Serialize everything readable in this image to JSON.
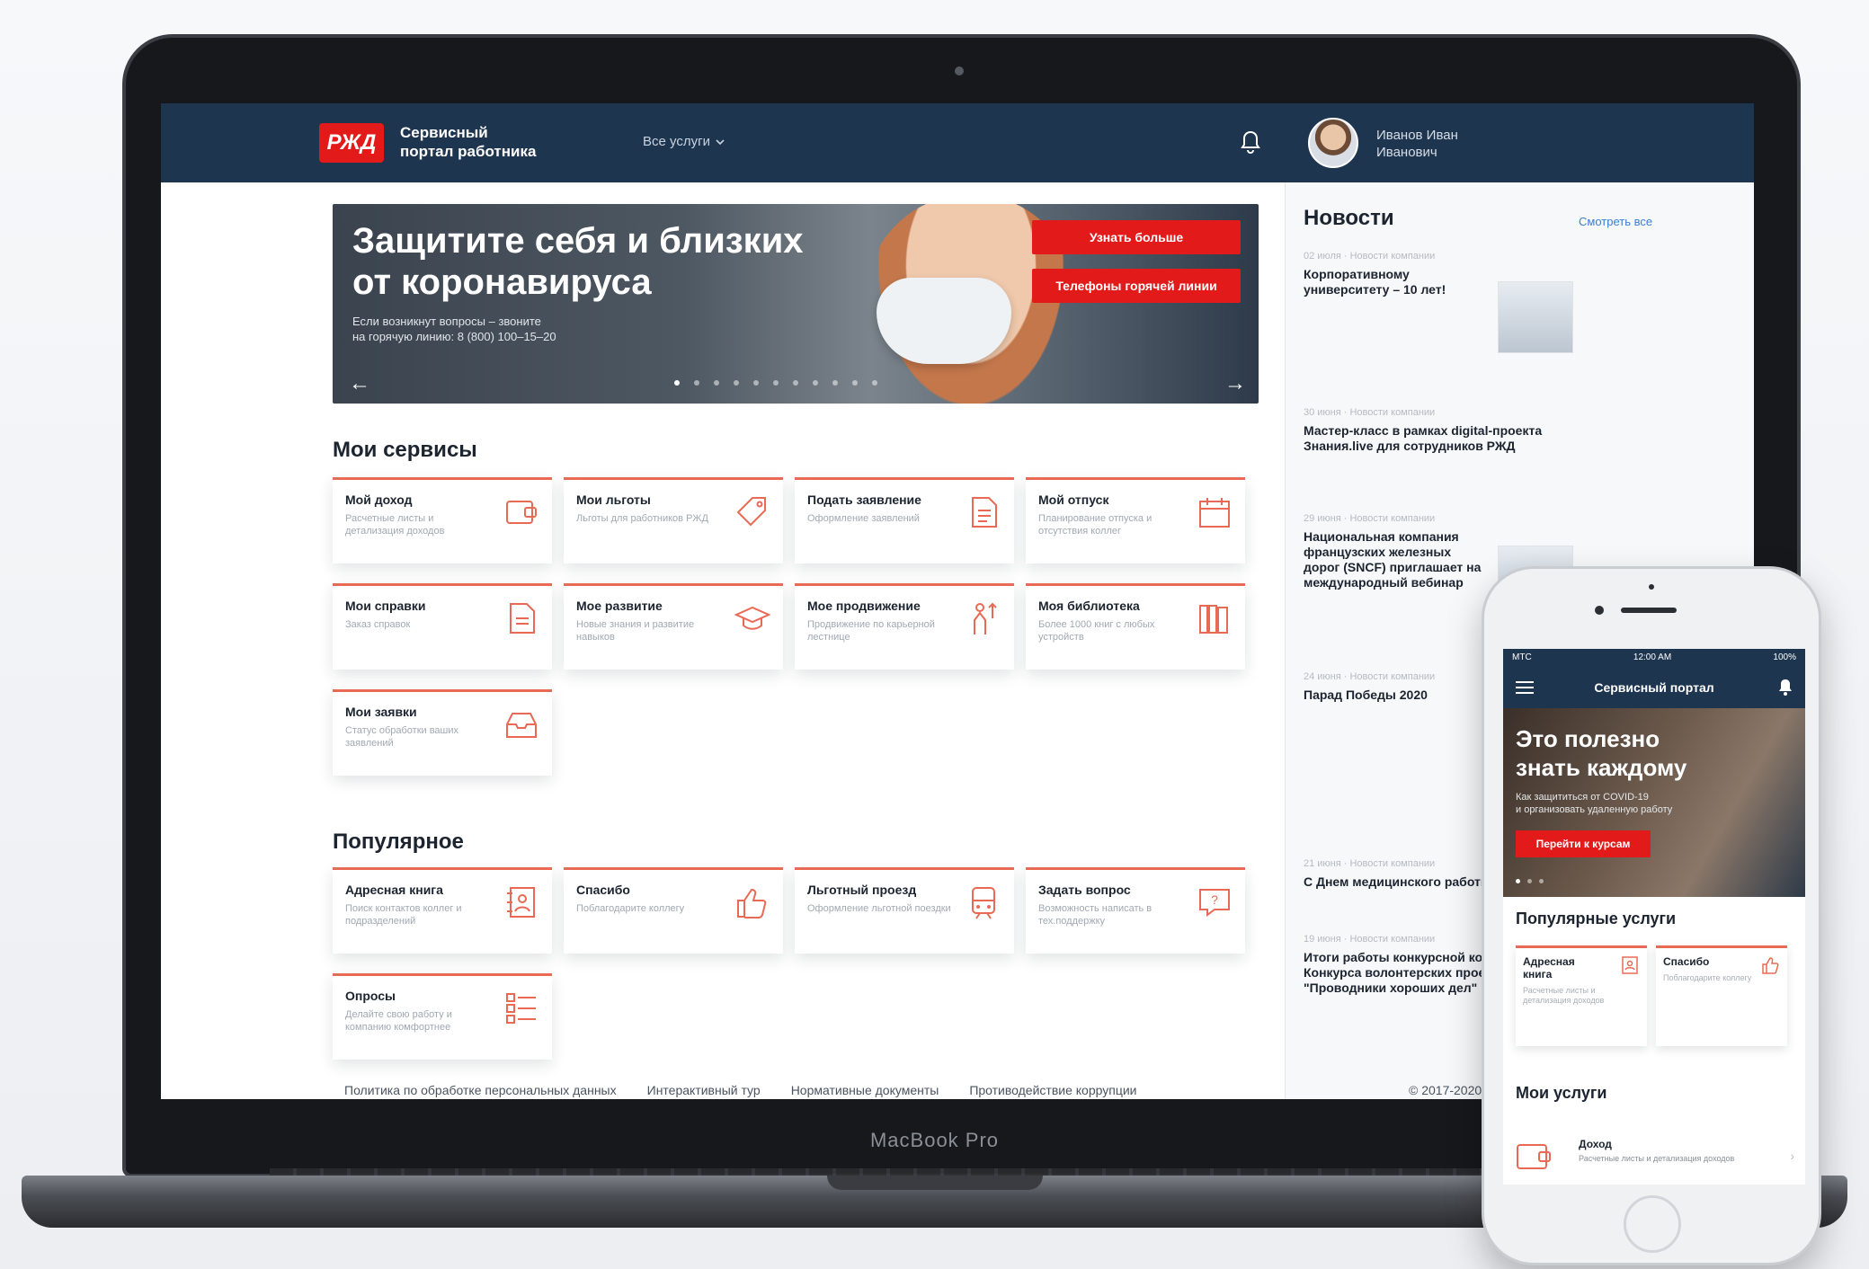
{
  "device": {
    "laptop_label": "MacBook Pro"
  },
  "header": {
    "brand_line1": "Сервисный",
    "brand_line2": "портал работника",
    "logo_text": "РЖД",
    "nav_services": "Все услуги",
    "user_name_line1": "Иванов Иван",
    "user_name_line2": "Иванович"
  },
  "hero": {
    "title_line1": "Защитите себя и близких",
    "title_line2": "от коронавируса",
    "subtitle_line1": "Если возникнут вопросы – звоните",
    "subtitle_line2": "на горячую линию: 8 (800) 100–15–20",
    "button_more": "Узнать больше",
    "button_hotline": "Телефоны горячей линии"
  },
  "my_services": {
    "title": "Мои сервисы",
    "items": [
      {
        "title": "Мой доход",
        "desc": "Расчетные листы и детализация доходов",
        "icon": "wallet-icon"
      },
      {
        "title": "Мои льготы",
        "desc": "Льготы для работников РЖД",
        "icon": "tag-icon"
      },
      {
        "title": "Подать заявление",
        "desc": "Оформление заявлений",
        "icon": "document-icon"
      },
      {
        "title": "Мой отпуск",
        "desc": "Планирование отпуска и отсутствия коллег",
        "icon": "calendar-icon"
      },
      {
        "title": "Мои справки",
        "desc": "Заказ справок",
        "icon": "certificate-icon"
      },
      {
        "title": "Мое развитие",
        "desc": "Новые знания и развитие навыков",
        "icon": "graduation-cap-icon"
      },
      {
        "title": "Мое продвижение",
        "desc": "Продвижение по карьерной лестнице",
        "icon": "career-icon"
      },
      {
        "title": "Моя библиотека",
        "desc": "Более 1000 книг с любых устройств",
        "icon": "library-icon"
      },
      {
        "title": "Мои заявки",
        "desc": "Статус обработки ваших заявлений",
        "icon": "inbox-icon"
      }
    ]
  },
  "popular": {
    "title": "Популярное",
    "items": [
      {
        "title": "Адресная книга",
        "desc": "Поиск контактов коллег и подразделений",
        "icon": "address-book-icon"
      },
      {
        "title": "Спасибо",
        "desc": "Поблагодарите коллегу",
        "icon": "thumbs-up-icon"
      },
      {
        "title": "Льготный проезд",
        "desc": "Оформление льготной поездки",
        "icon": "train-icon"
      },
      {
        "title": "Задать вопрос",
        "desc": "Возможность написать в тех.поддержку",
        "icon": "question-icon"
      },
      {
        "title": "Опросы",
        "desc": "Делайте свою работу и компанию комфортнее",
        "icon": "survey-icon"
      }
    ]
  },
  "news": {
    "title": "Новости",
    "see_all": "Смотреть все",
    "items": [
      {
        "meta": "02 июля · Новости компании",
        "headline": "Корпоративному университету – 10 лет!"
      },
      {
        "meta": "30 июня · Новости компании",
        "headline": "Мастер-класс в рамках digital-проекта Знания.live для сотрудников РЖД"
      },
      {
        "meta": "29 июня · Новости компании",
        "headline": "Национальная компания французских железных дорог (SNCF) приглашает на международный вебинар"
      },
      {
        "meta": "24 июня · Новости компании",
        "headline": "Парад Победы 2020"
      },
      {
        "meta": "21 июня · Новости компании",
        "headline": "С Днем медицинского работника"
      },
      {
        "meta": "19 июня · Новости компании",
        "headline": "Итоги работы конкурсной комиссии Конкурса волонтерских проектов \"Проводники хороших дел\""
      }
    ]
  },
  "footer": {
    "links": [
      "Политика по обработке персональных данных",
      "Интерактивный тур",
      "Нормативные документы",
      "Противодействие коррупции"
    ],
    "copyright": "© 2017-2020"
  },
  "phone": {
    "status_left": "MTC",
    "status_time": "12:00 AM",
    "status_right": "100%",
    "app_title": "Сервисный портал",
    "hero_title_line1": "Это полезно",
    "hero_title_line2": "знать каждому",
    "hero_sub_line1": "Как защититься от COVID-19",
    "hero_sub_line2": "и организовать удаленную работу",
    "hero_button": "Перейти к курсам",
    "popular_title": "Популярные услуги",
    "popular_items": [
      {
        "title": "Адресная книга",
        "desc": "Расчетные листы и детализация доходов"
      },
      {
        "title": "Спасибо",
        "desc": "Поблагодарите коллегу"
      }
    ],
    "my_services_title": "Мои услуги",
    "list_item": {
      "title": "Доход",
      "desc": "Расчетные листы и детализация доходов"
    }
  },
  "colors": {
    "accent": "#e21a1a",
    "header": "#1e3550",
    "card_border": "#e86a55"
  }
}
